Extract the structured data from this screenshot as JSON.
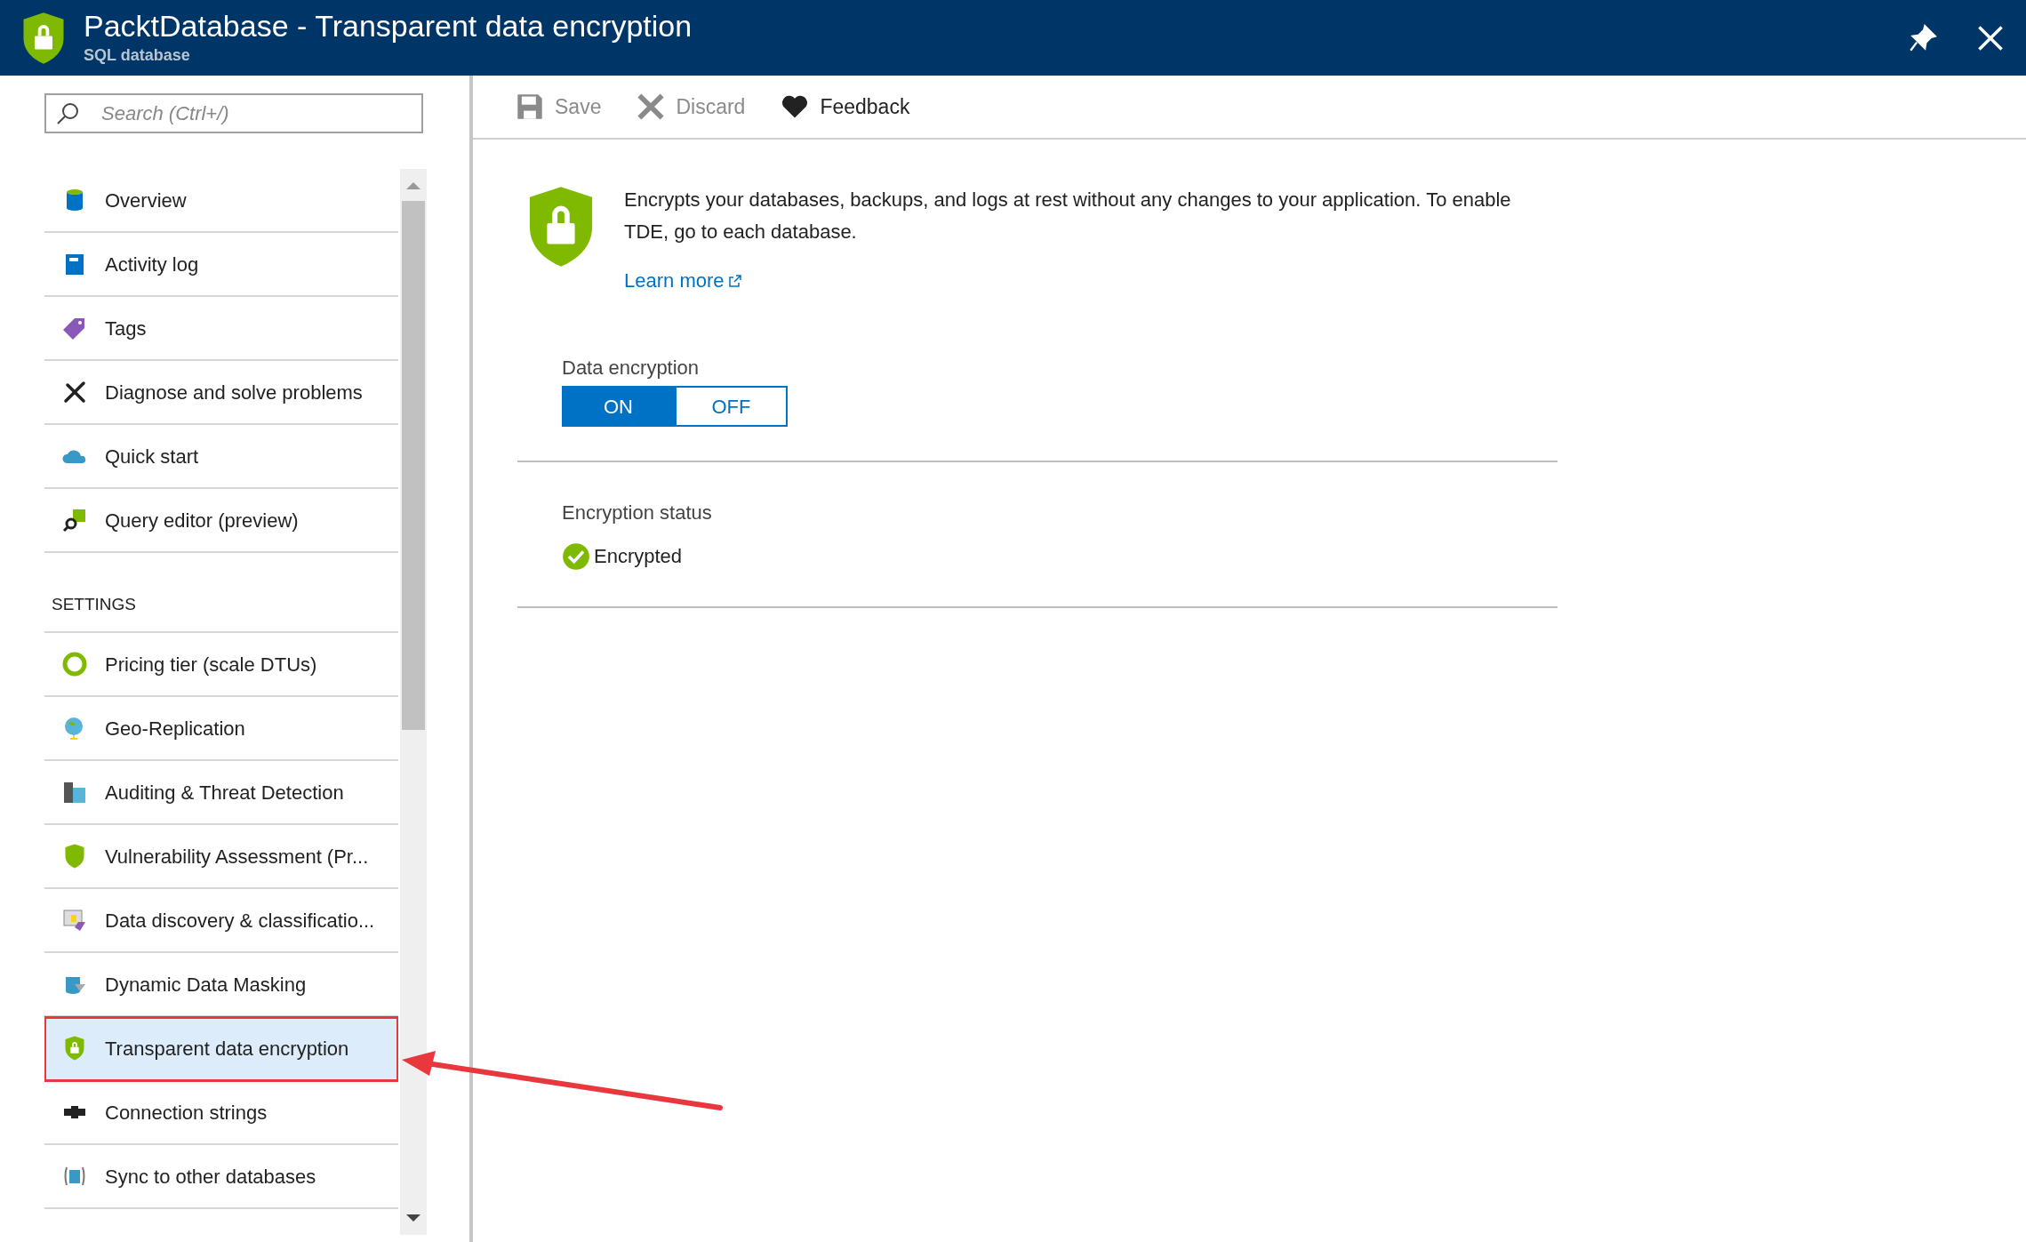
{
  "header": {
    "title": "PacktDatabase - Transparent data encryption",
    "subtitle": "SQL database"
  },
  "sidebar": {
    "search": {
      "placeholder": "Search (Ctrl+/)"
    },
    "items": [
      {
        "label": "Overview",
        "selected": false
      },
      {
        "label": "Activity log",
        "selected": false
      },
      {
        "label": "Tags",
        "selected": false
      },
      {
        "label": "Diagnose and solve problems",
        "selected": false
      },
      {
        "label": "Quick start",
        "selected": false
      },
      {
        "label": "Query editor (preview)",
        "selected": false
      }
    ],
    "section": "SETTINGS",
    "settings_items": [
      {
        "label": "Pricing tier (scale DTUs)",
        "selected": false
      },
      {
        "label": "Geo-Replication",
        "selected": false
      },
      {
        "label": "Auditing & Threat Detection",
        "selected": false
      },
      {
        "label": "Vulnerability Assessment (Pr...",
        "selected": false
      },
      {
        "label": "Data discovery & classificatio...",
        "selected": false
      },
      {
        "label": "Dynamic Data Masking",
        "selected": false
      },
      {
        "label": "Transparent data encryption",
        "selected": true
      },
      {
        "label": "Connection strings",
        "selected": false
      },
      {
        "label": "Sync to other databases",
        "selected": false
      }
    ]
  },
  "toolbar": [
    {
      "label": "Save",
      "disabled": true
    },
    {
      "label": "Discard",
      "disabled": true
    },
    {
      "label": "Feedback",
      "disabled": false
    }
  ],
  "description": "Encrypts your databases, backups, and logs at rest without any changes to your application. To enable TDE, go to each database.",
  "learn_more": "Learn more",
  "data_encryption": {
    "label": "Data encryption",
    "options": [
      {
        "label": "ON",
        "selected": true
      },
      {
        "label": "OFF",
        "selected": false
      }
    ]
  },
  "encryption_status": {
    "label": "Encryption status",
    "value": "Encrypted"
  }
}
